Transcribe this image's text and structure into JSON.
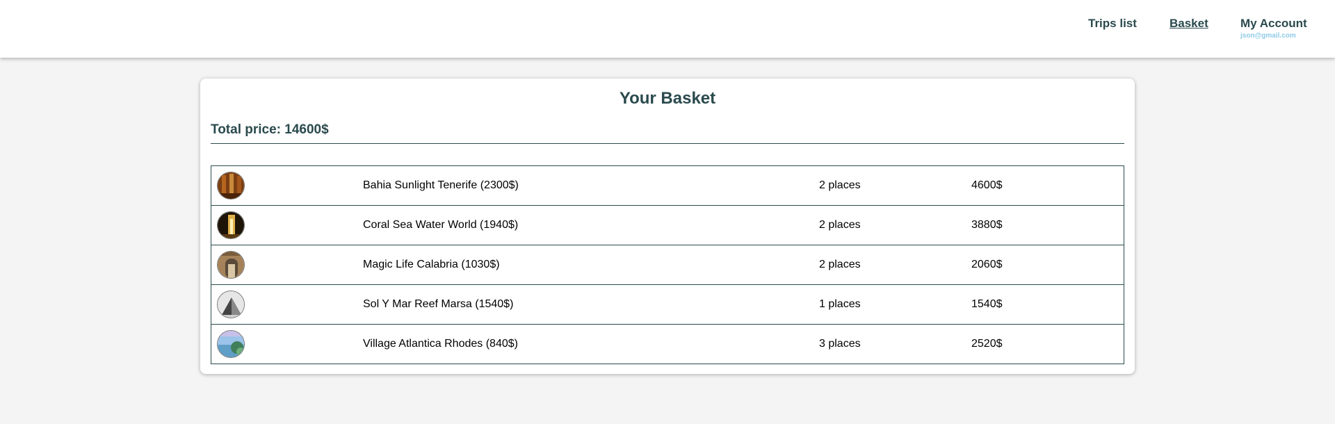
{
  "nav": {
    "trips_label": "Trips list",
    "basket_label": "Basket",
    "account_label": "My Account",
    "account_email": "json@gmail.com"
  },
  "basket": {
    "title": "Your Basket",
    "total_label": "Total price: 14600$",
    "items": [
      {
        "name": "Bahia Sunlight Tenerife (2300$)",
        "places": "2 places",
        "price": "4600$"
      },
      {
        "name": "Coral Sea Water World (1940$)",
        "places": "2 places",
        "price": "3880$"
      },
      {
        "name": "Magic Life Calabria (1030$)",
        "places": "2 places",
        "price": "2060$"
      },
      {
        "name": "Sol Y Mar Reef Marsa (1540$)",
        "places": "1 places",
        "price": "1540$"
      },
      {
        "name": "Village Atlantica Rhodes (840$)",
        "places": "3 places",
        "price": "2520$"
      }
    ]
  },
  "colors": {
    "accent": "#2a4a4d",
    "email": "#8ecae6",
    "background": "#f4f4f4"
  }
}
